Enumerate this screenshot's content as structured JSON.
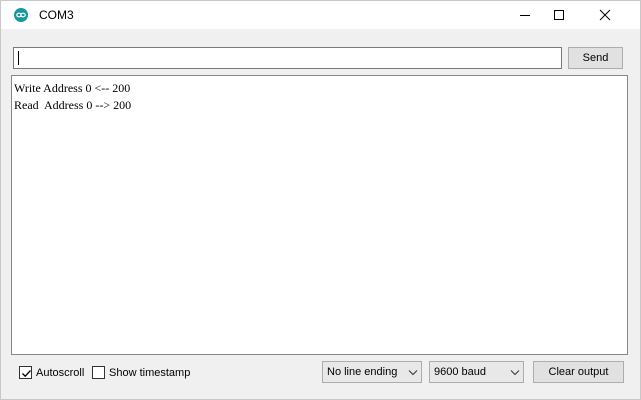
{
  "window": {
    "title": "COM3",
    "icon": "arduino-icon"
  },
  "send_bar": {
    "input_value": "",
    "send_label": "Send"
  },
  "output": {
    "lines": [
      "Write Address 0 <-- 200",
      "Read  Address 0 --> 200"
    ]
  },
  "bottom_bar": {
    "autoscroll_label": "Autoscroll",
    "autoscroll_checked": true,
    "timestamp_label": "Show timestamp",
    "timestamp_checked": false,
    "line_ending": "No line ending",
    "baud_rate": "9600 baud",
    "clear_label": "Clear output"
  },
  "colors": {
    "accent": "#16989f"
  }
}
